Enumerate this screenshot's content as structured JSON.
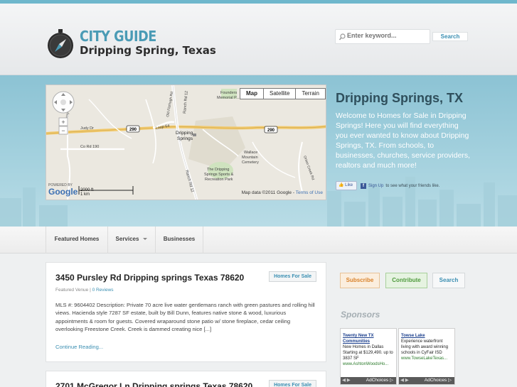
{
  "header": {
    "logo_title": "CITY GUIDE",
    "logo_subtitle": "Dripping Spring, Texas",
    "search_placeholder": "Enter keyword...",
    "search_button": "Search"
  },
  "map": {
    "types": [
      "Map",
      "Satellite",
      "Terrain"
    ],
    "active_type": "Map",
    "labels": {
      "judy": "Judy Dr",
      "co_rd": "Co Rd 190",
      "rodgers": "Rodgers Pkwy",
      "loop": "Loop 64",
      "old_fitz": "Old Fitzhugh Rd",
      "ranch_rd_top": "Ranch Rd 12",
      "ranch_rd_bottom": "Ranch Rd 12",
      "founders1": "Founders",
      "founders2": "Memorial P...",
      "dripping1": "Dripping",
      "dripping2": "Springs",
      "wallace1": "Wallace",
      "wallace2": "Mountain",
      "wallace3": "Cemetery",
      "park1": "The Dripping",
      "park2": "Springs Sports &",
      "park3": "Recreation Park",
      "hwy_a": "290",
      "hwy_b": "290",
      "creek": "Onion Creek Rd"
    },
    "scale_ft": "2000 ft",
    "scale_km": "1 km",
    "powered_by": "POWERED BY",
    "google": "Google",
    "copyright": "Map data ©2011 Google - ",
    "terms": "Terms of Use"
  },
  "hero": {
    "title": "Dripping Springs, TX",
    "text": "Welcome to Homes for Sale in Dripping Springs! Here you will find everything you ever wanted to know about Dripping Springs, TX. From schools, to businesses, churches, service providers, realtors and much more!",
    "like_label": "Like",
    "sign_up": "Sign Up",
    "like_text": "to see what your friends like."
  },
  "nav": {
    "items": [
      "Featured Homes",
      "Services",
      "Businesses"
    ]
  },
  "posts": [
    {
      "title": "3450 Pursley Rd Dripping springs Texas 78620",
      "tag": "Homes For Sale",
      "meta_prefix": "Featured Venue | ",
      "reviews": "0 Reviews",
      "body": "MLS #: 9604402 Description: Private 70 acre live water gentlemans ranch with green pastures and rolling hill views. Hacienda style 7287 SF estate, built by Bill Dunn, features native stone & wood, luxurious appointments & room for guests. Covered wraparound stone patio w/ stone fireplace, cedar ceiling overlooking Freestone Creek. Creek is dammed creating nice [...]",
      "more": "Continue Reading..."
    },
    {
      "title": "2701 McGregor Ln Dripping springs Texas 78620",
      "tag": "Homes For Sale"
    }
  ],
  "sidebar": {
    "subscribe": "Subscribe",
    "contribute": "Contribute",
    "search": "Search",
    "sponsors_title": "Sponsors",
    "ads": [
      {
        "title": "Twenty New TX Communities",
        "text": "New Homes in Dallas Starting at $129,490. up to 3837 SF",
        "url": "www.AshtonWoodsHo..."
      },
      {
        "title": "Towse Lake",
        "text": "Experience waterfront living with award winning schools in CyFair ISD",
        "url": "www.TowseLakeTexas..."
      }
    ],
    "adchoices": "AdChoices"
  },
  "colors": {
    "accent": "#4a9bb5",
    "link": "#3b8fb2",
    "hero_sky": "#8cc3d4"
  }
}
